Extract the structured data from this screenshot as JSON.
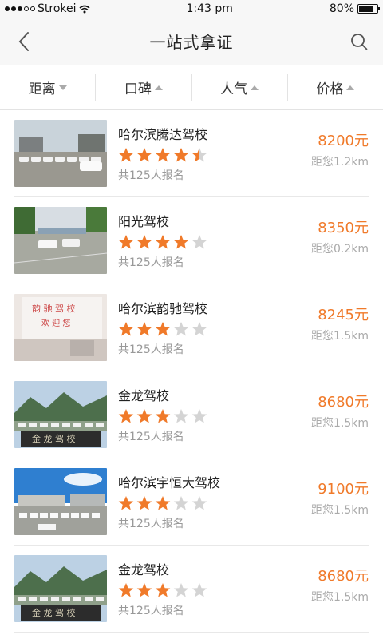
{
  "status": {
    "carrier": "Strokei",
    "time": "1:43 pm",
    "battery": "80%",
    "battery_level": 0.8
  },
  "nav": {
    "title": "一站式拿证"
  },
  "sort_tabs": [
    {
      "label": "距离",
      "arrow": "down"
    },
    {
      "label": "口碑",
      "arrow": "up"
    },
    {
      "label": "人气",
      "arrow": "up"
    },
    {
      "label": "价格",
      "arrow": "up"
    }
  ],
  "schools": [
    {
      "name": "哈尔滨腾达驾校",
      "rating": 4.5,
      "signup": "共125人报名",
      "price": "8200元",
      "distance": "距您1.2km",
      "photo": "parking-lot"
    },
    {
      "name": "阳光驾校",
      "rating": 4,
      "signup": "共125人报名",
      "price": "8350元",
      "distance": "距您0.2km",
      "photo": "training-yard"
    },
    {
      "name": "哈尔滨韵驰驾校",
      "rating": 3,
      "signup": "共125人报名",
      "price": "8245元",
      "distance": "距您1.5km",
      "photo": "office-banner"
    },
    {
      "name": "金龙驾校",
      "rating": 3,
      "signup": "共125人报名",
      "price": "8680元",
      "distance": "距您1.5km",
      "photo": "mountain-sign"
    },
    {
      "name": "哈尔滨宇恒大驾校",
      "rating": 3,
      "signup": "共125人报名",
      "price": "9100元",
      "distance": "距您1.5km",
      "photo": "blue-sky-lot"
    },
    {
      "name": "金龙驾校",
      "rating": 3,
      "signup": "共125人报名",
      "price": "8680元",
      "distance": "距您1.5km",
      "photo": "mountain-sign"
    }
  ],
  "colors": {
    "accent": "#f07a2a",
    "star_on": "#f07a2a",
    "star_off": "#d4d4d4"
  }
}
